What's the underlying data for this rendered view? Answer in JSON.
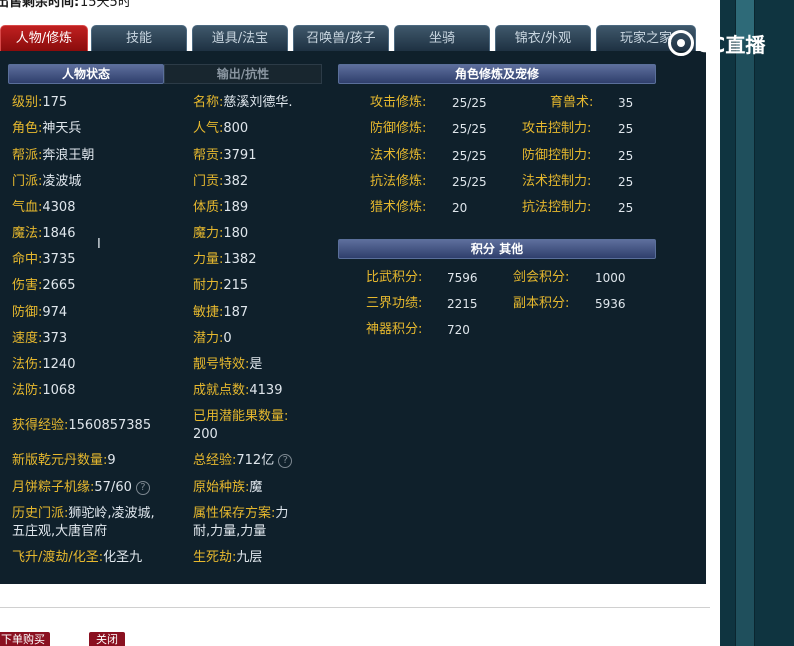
{
  "header": {
    "label": "出售剩余时间:",
    "value": "15天5时"
  },
  "tabs": [
    "人物/修炼",
    "技能",
    "道具/法宝",
    "召唤兽/孩子",
    "坐骑",
    "锦衣/外观",
    "玩家之家"
  ],
  "left_panel": {
    "tab_active": "人物状态",
    "tab_inactive": "输出/抗性",
    "col1": [
      {
        "label": "级别:",
        "value": "175"
      },
      {
        "label": "角色:",
        "value": "神天兵"
      },
      {
        "label": "帮派:",
        "value": "奔浪王朝"
      },
      {
        "label": "门派:",
        "value": "凌波城"
      },
      {
        "label": "气血:",
        "value": "4308"
      },
      {
        "label": "魔法:",
        "value": "1846"
      },
      {
        "label": "命中:",
        "value": "3735"
      },
      {
        "label": "伤害:",
        "value": "2665"
      },
      {
        "label": "防御:",
        "value": "974"
      },
      {
        "label": "速度:",
        "value": "373"
      },
      {
        "label": "法伤:",
        "value": "1240"
      },
      {
        "label": "法防:",
        "value": "1068"
      }
    ],
    "col2": [
      {
        "label": "名称:",
        "value": "慈溪刘德华."
      },
      {
        "label": "人气:",
        "value": "800"
      },
      {
        "label": "帮贡:",
        "value": "3791"
      },
      {
        "label": "门贡:",
        "value": "382"
      },
      {
        "label": "体质:",
        "value": "189"
      },
      {
        "label": "魔力:",
        "value": "180"
      },
      {
        "label": "力量:",
        "value": "1382"
      },
      {
        "label": "耐力:",
        "value": "215"
      },
      {
        "label": "敏捷:",
        "value": "187"
      },
      {
        "label": "潜力:",
        "value": "0"
      },
      {
        "label": "靓号特效:",
        "value": "是"
      },
      {
        "label": "成就点数:",
        "value": "4139"
      }
    ],
    "extra": {
      "exp_label": "获得经验:",
      "exp_value": "1560857385",
      "potion_label": "已用潜能果数量:",
      "potion_value": "200",
      "qianyuan_label": "新版乾元丹数量:",
      "qianyuan_value": "9",
      "total_exp_label": "总经验:",
      "total_exp_value": "712亿",
      "zongzi_label": "月饼粽子机缘:",
      "zongzi_value": "57/60",
      "race_label": "原始种族:",
      "race_value": "魔",
      "history_label": "历史门派:",
      "history_value_1": "狮驼岭,凌波城,",
      "history_value_2": "五庄观,大唐官府",
      "attr_label": "属性保存方案:",
      "attr_value_1": "力",
      "attr_value_2": "耐,力量,力量",
      "ascend_label": "飞升/渡劫/化圣:",
      "ascend_value": "化圣九",
      "life_label": "生死劫:",
      "life_value": "九层"
    }
  },
  "cultivation": {
    "title": "角色修炼及宠修",
    "rows": [
      {
        "label": "攻击修炼:",
        "value": "25/25",
        "label2": "育兽术:",
        "value2": "35"
      },
      {
        "label": "防御修炼:",
        "value": "25/25",
        "label2": "攻击控制力:",
        "value2": "25"
      },
      {
        "label": "法术修炼:",
        "value": "25/25",
        "label2": "防御控制力:",
        "value2": "25"
      },
      {
        "label": "抗法修炼:",
        "value": "25/25",
        "label2": "法术控制力:",
        "value2": "25"
      },
      {
        "label": "猎术修炼:",
        "value": "20",
        "label2": "抗法控制力:",
        "value2": "25"
      }
    ]
  },
  "score": {
    "title": "积分 其他",
    "rows": [
      {
        "label": "比武积分:",
        "value": "7596",
        "label2": "剑会积分:",
        "value2": "1000"
      },
      {
        "label": "三界功绩:",
        "value": "2215",
        "label2": "副本积分:",
        "value2": "5936"
      },
      {
        "label": "神器积分:",
        "value": "720",
        "label2": "",
        "value2": ""
      }
    ]
  },
  "logo": "CC直播",
  "question_mark": "?",
  "buttons": {
    "buy": "下单购买",
    "close": "关闭"
  }
}
